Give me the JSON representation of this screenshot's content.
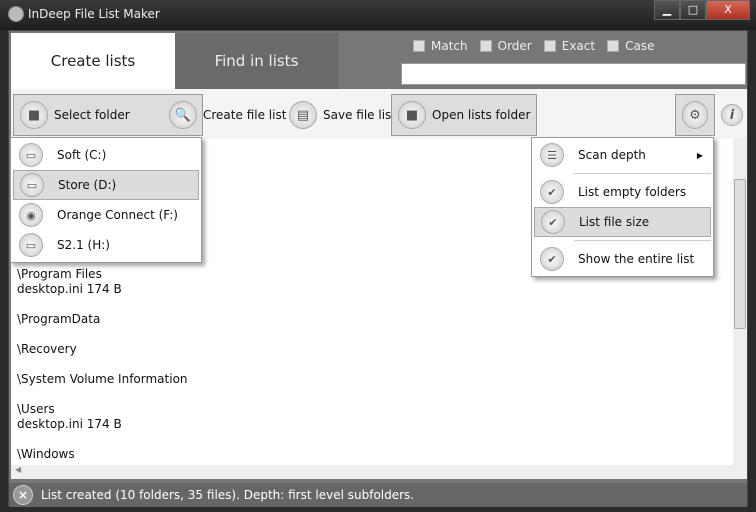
{
  "window": {
    "title": "InDeep File List Maker",
    "minimize": "▁",
    "maximize": "□",
    "close": "X"
  },
  "tabs": [
    {
      "label": "Create lists",
      "active": true
    },
    {
      "label": "Find in lists",
      "active": false
    }
  ],
  "search": {
    "options": [
      "Match",
      "Order",
      "Exact",
      "Case"
    ],
    "value": ""
  },
  "toolbar": {
    "select_folder": "Select folder",
    "create_file_list": "Create file list",
    "save_file_list": "Save file list",
    "open_lists_folder": "Open lists folder",
    "info": "i"
  },
  "drive_menu": [
    {
      "label": "Soft (C:)"
    },
    {
      "label": "Store (D:)",
      "selected": true
    },
    {
      "label": "Orange Connect (F:)"
    },
    {
      "label": "S2.1 (H:)"
    }
  ],
  "settings_menu": [
    {
      "label": "Scan depth",
      "submenu": true
    },
    {
      "label": "List empty folders",
      "checked": true
    },
    {
      "label": "List file size",
      "checked": true,
      "selected": true
    },
    {
      "label": "Show the entire list",
      "checked": true
    }
  ],
  "content": [
    {
      "folder": "\\Program Files",
      "file": "desktop.ini    174 B"
    },
    {
      "folder": "\\ProgramData"
    },
    {
      "folder": "\\Recovery"
    },
    {
      "folder": "\\System Volume Information"
    },
    {
      "folder": "\\Users",
      "file": "desktop.ini    174 B"
    },
    {
      "folder": "\\Windows"
    }
  ],
  "status": {
    "text": "List created (10 folders, 35 files).  Depth: first level subfolders."
  }
}
